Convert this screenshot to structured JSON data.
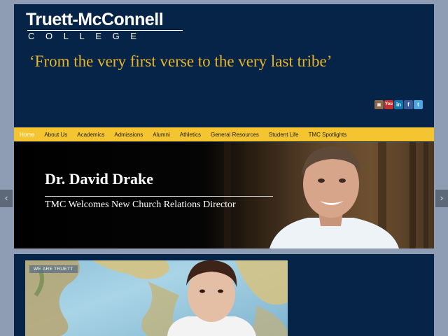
{
  "logo": {
    "name": "Truett-McConnell",
    "college": "COLLEGE"
  },
  "tagline": "‘From the very first verse to the very last tribe’",
  "social": [
    {
      "icon": "instagram-icon",
      "glyph": "◙"
    },
    {
      "icon": "youtube-icon",
      "glyph": "You"
    },
    {
      "icon": "linkedin-icon",
      "glyph": "in"
    },
    {
      "icon": "facebook-icon",
      "glyph": "f"
    },
    {
      "icon": "twitter-icon",
      "glyph": "t"
    }
  ],
  "nav": [
    "Home",
    "About Us",
    "Academics",
    "Admissions",
    "Alumni",
    "Athletics",
    "General Resources",
    "Student Life",
    "TMC Spotlights"
  ],
  "banner": {
    "title": "Dr. David Drake",
    "subtitle": "TMC Welcomes New Church Relations Director"
  },
  "feature": {
    "badge": "WE ARE TRUETT"
  },
  "slider": {
    "prev": "‹",
    "next": "›"
  },
  "colors": {
    "navy": "#062447",
    "gold": "#f4c531",
    "tagline": "#e8b529",
    "page": "#8e9db3"
  }
}
